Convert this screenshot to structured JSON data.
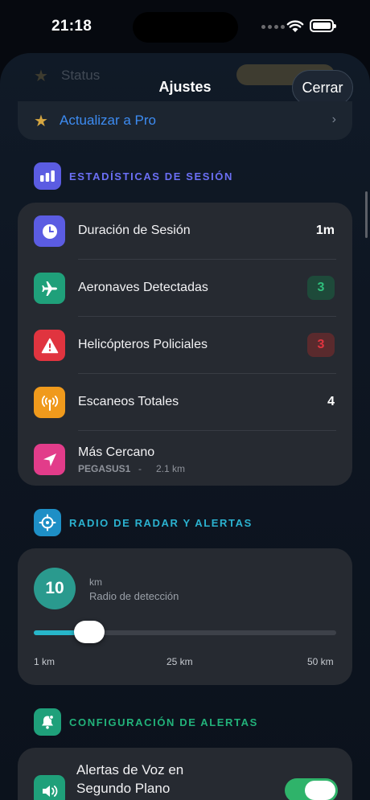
{
  "status_bar": {
    "time": "21:18"
  },
  "sheet": {
    "title": "Ajustes",
    "close_label": "Cerrar",
    "ghost_row_label": "Status",
    "upgrade": {
      "label": "Actualizar a Pro",
      "chevron": "›"
    }
  },
  "session_stats": {
    "section_title": "ESTADÍSTICAS DE SESIÓN",
    "section_icon": "chart-bars-icon",
    "rows": [
      {
        "label": "Duración de Sesión",
        "value": "1m",
        "icon": "clock-icon",
        "icon_color": "#5b5ce2"
      },
      {
        "label": "Aeronaves Detectadas",
        "value": "3",
        "icon": "airplane-icon",
        "icon_color": "#1fa07a",
        "badge_bg": "#1e4a3a",
        "badge_fg": "#2fbf7c"
      },
      {
        "label": "Helicópteros Policiales",
        "value": "3",
        "icon": "warning-icon",
        "icon_color": "#e0343f",
        "badge_bg": "#5a2a2d",
        "badge_fg": "#e0343f"
      },
      {
        "label": "Escaneos Totales",
        "value": "4",
        "icon": "antenna-icon",
        "icon_color": "#f09a1c"
      },
      {
        "label": "Más Cercano",
        "sub_name": "PEGASUS1",
        "sub_sep": "-",
        "sub_distance": "2.1 km",
        "icon": "location-arrow-icon",
        "icon_color": "#e23c8a"
      }
    ]
  },
  "radar": {
    "section_title": "RADIO DE RADAR Y ALERTAS",
    "section_icon": "crosshair-icon",
    "value": "10",
    "unit": "km",
    "description": "Radio de detección",
    "slider_fraction": 0.184,
    "ticks": [
      "1 km",
      "25 km",
      "50 km"
    ]
  },
  "alerts": {
    "section_title": "CONFIGURACIÓN DE ALERTAS",
    "section_icon": "bell-icon",
    "voice_label_line1": "Alertas de Voz en",
    "voice_label_line2": "Segundo Plano",
    "voice_enabled": true
  },
  "colors": {
    "stats_title": "#6b6ff5",
    "radar_title": "#2bb2d0",
    "alerts_title": "#22b27a",
    "accent_blue": "#3d8cf2"
  }
}
